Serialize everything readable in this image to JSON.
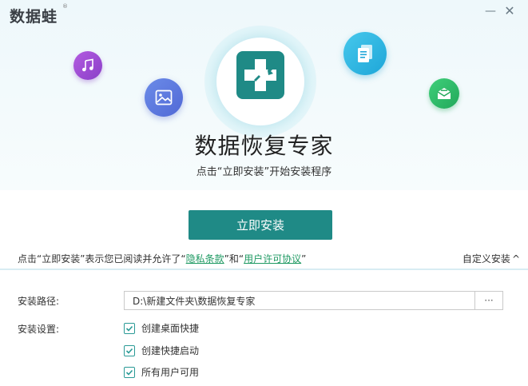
{
  "app": {
    "logo_text": "数据蛙",
    "logo_mark": "®"
  },
  "window_controls": {
    "minimize_glyph": "—",
    "close_glyph": "✕"
  },
  "hero": {
    "title": "数据恢复专家",
    "subtitle": "点击“立即安装”开始安装程序",
    "icons": [
      "music-icon",
      "image-icon",
      "documents-icon",
      "mail-icon",
      "medical-cross-icon"
    ]
  },
  "install": {
    "button_label": "立即安装"
  },
  "agreement": {
    "prefix": "点击“立即安装”表示您已阅读并允许了“",
    "privacy_link": "隐私条款",
    "middle": "”和“",
    "license_link": "用户许可协议",
    "suffix": "”"
  },
  "custom_install": {
    "label": "自定义安装",
    "chevron": "^"
  },
  "settings": {
    "path_label": "安装路径:",
    "path_value": "D:\\新建文件夹\\数据恢复专家",
    "browse_label": "···",
    "options_label": "安装设置:",
    "options": [
      {
        "label": "创建桌面快捷",
        "checked": true
      },
      {
        "label": "创建快捷启动",
        "checked": true
      },
      {
        "label": "所有用户可用",
        "checked": true
      }
    ]
  },
  "colors": {
    "accent": "#1f8a86",
    "link": "#1f9a63",
    "hero_bg": "#eef8fb"
  }
}
